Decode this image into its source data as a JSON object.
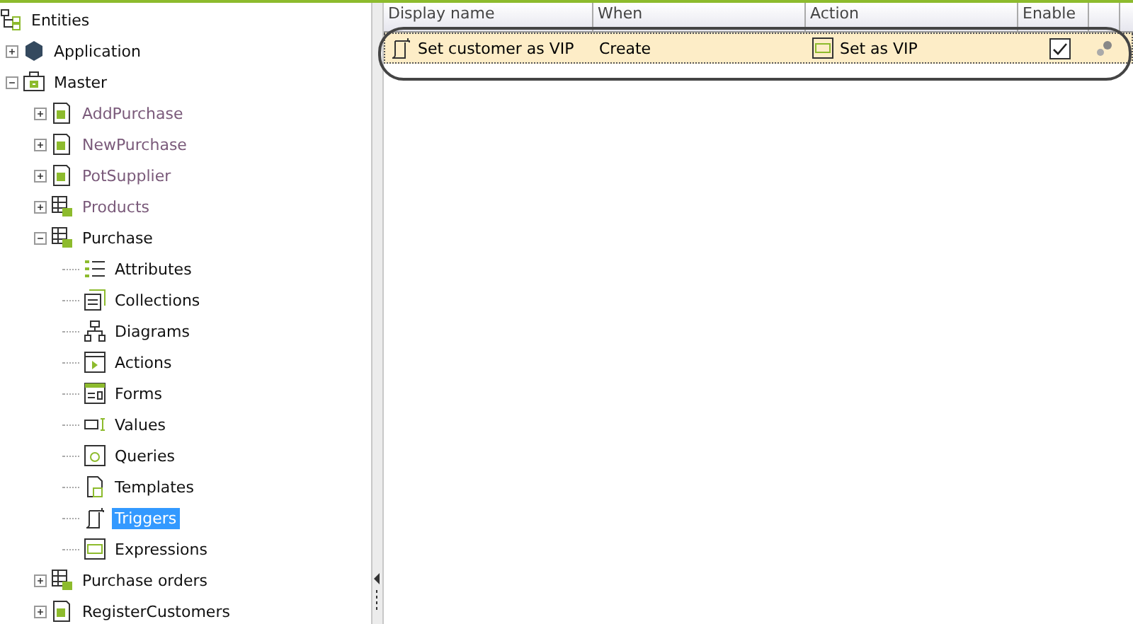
{
  "tree": {
    "label": "Entities",
    "kind": "root",
    "children": [
      {
        "label": "Application",
        "kind": "app",
        "expanded": false,
        "blurred": false,
        "selected": false
      },
      {
        "label": "Master",
        "kind": "module",
        "expanded": true,
        "blurred": false,
        "selected": false,
        "children": [
          {
            "label": "AddPurchase",
            "kind": "form",
            "expanded": false,
            "blurred": true,
            "selected": false
          },
          {
            "label": "NewPurchase",
            "kind": "form",
            "expanded": false,
            "blurred": true,
            "selected": false
          },
          {
            "label": "PotSupplier",
            "kind": "form",
            "expanded": false,
            "blurred": true,
            "selected": false
          },
          {
            "label": "Products",
            "kind": "entity",
            "expanded": false,
            "blurred": true,
            "selected": false
          },
          {
            "label": "Purchase",
            "kind": "entity",
            "expanded": true,
            "blurred": false,
            "selected": false,
            "children": [
              {
                "label": "Attributes",
                "kind": "attributes",
                "blurred": false,
                "selected": false
              },
              {
                "label": "Collections",
                "kind": "collections",
                "blurred": false,
                "selected": false
              },
              {
                "label": "Diagrams",
                "kind": "diagrams",
                "blurred": false,
                "selected": false
              },
              {
                "label": "Actions",
                "kind": "actions",
                "blurred": false,
                "selected": false
              },
              {
                "label": "Forms",
                "kind": "forms",
                "blurred": false,
                "selected": false
              },
              {
                "label": "Values",
                "kind": "values",
                "blurred": false,
                "selected": false
              },
              {
                "label": "Queries",
                "kind": "queries",
                "blurred": false,
                "selected": false
              },
              {
                "label": "Templates",
                "kind": "templates",
                "blurred": false,
                "selected": false
              },
              {
                "label": "Triggers",
                "kind": "triggers",
                "blurred": false,
                "selected": true
              },
              {
                "label": "Expressions",
                "kind": "expressions",
                "blurred": false,
                "selected": false
              }
            ]
          },
          {
            "label": "Purchase orders",
            "kind": "entity",
            "expanded": false,
            "blurred": false,
            "selected": false
          },
          {
            "label": "RegisterCustomers",
            "kind": "form",
            "expanded": false,
            "blurred": false,
            "selected": false
          }
        ]
      }
    ]
  },
  "grid": {
    "columns": [
      "Display name",
      "When",
      "Action",
      "Enable"
    ],
    "rows": [
      {
        "display_name": "Set customer as VIP",
        "when": "Create",
        "action": "Set as VIP",
        "enable": true,
        "selected": true
      }
    ]
  }
}
